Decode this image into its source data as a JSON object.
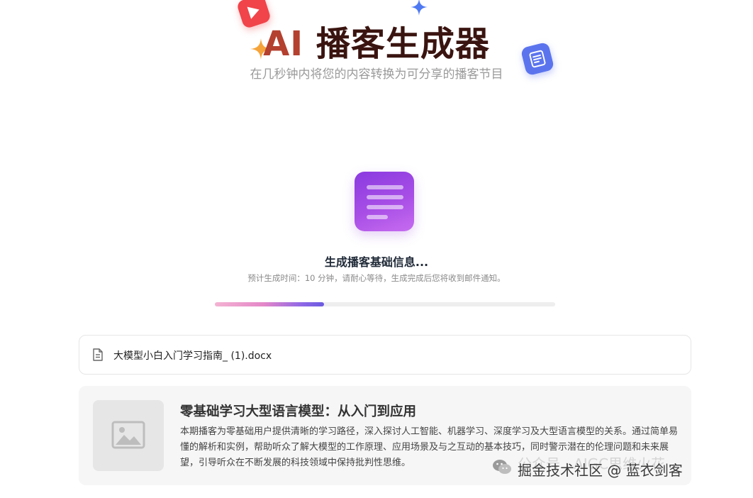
{
  "header": {
    "title_prefix": "AI",
    "title_rest": "播客生成器",
    "subtitle": "在几秒钟内将您的内容转换为可分享的播客节目"
  },
  "icons": {
    "play_badge": "play-icon",
    "doc_badge": "document-icon",
    "sparkle_orange": "sparkle-icon",
    "sparkle_blue": "sparkle-icon",
    "status": "document-icon",
    "file": "file-icon",
    "thumbnail": "image-placeholder-icon",
    "watermark": "wechat-icon"
  },
  "status": {
    "title": "生成播客基础信息...",
    "note": "预计生成时间：10 分钟，请耐心等待，生成完成后您将收到邮件通知。",
    "progress": 0.32
  },
  "file": {
    "name": "大模型小白入门学习指南_ (1).docx"
  },
  "episode": {
    "title": "零基础学习大型语言模型：从入门到应用",
    "description": "本期播客为零基础用户提供清晰的学习路径，深入探讨人工智能、机器学习、深度学习及大型语言模型的关系。通过简单易懂的解析和实例，帮助听众了解大模型的工作原理、应用场景及与之互动的基本技巧，同时警示潜在的伦理问题和未来展望，引导听众在不断发展的科技领域中保持批判性思维。"
  },
  "watermark": {
    "faded_text": "公众号 · AIGC思维火花",
    "text": "掘金技术社区 @ 蓝衣剑客"
  },
  "colors": {
    "title_accent": "#b4402f",
    "title_dark": "#3a1410",
    "play_badge": "#f0444a",
    "doc_badge": "#5b74ee",
    "status_icon": "#a84ee6",
    "progress_start": "#f4b3d2",
    "progress_end": "#6a5ae0"
  }
}
